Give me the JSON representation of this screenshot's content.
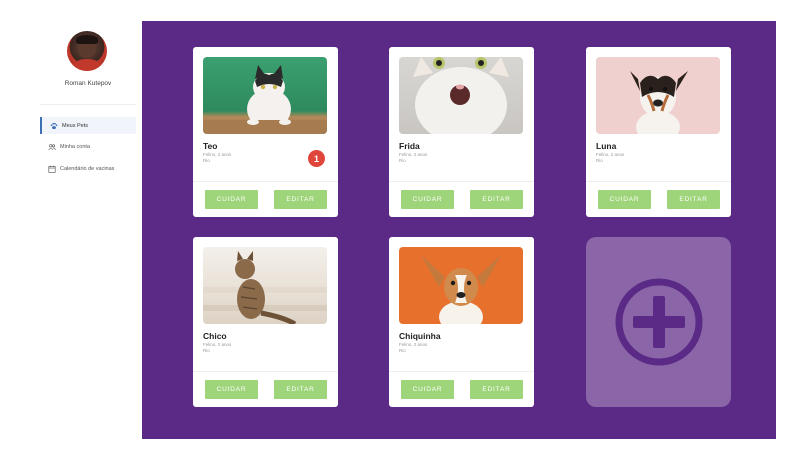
{
  "user": {
    "name": "Roman Kutepov"
  },
  "nav": {
    "items": [
      {
        "label": "Meus Pets",
        "icon": "paw-icon",
        "active": true
      },
      {
        "label": "Minha conta",
        "icon": "people-icon",
        "active": false
      },
      {
        "label": "Calendário de vacinas",
        "icon": "calendar-icon",
        "active": false
      }
    ]
  },
  "pets": [
    {
      "name": "Teo",
      "meta": "Felino, 2 anos",
      "sub": "Rio",
      "badge": "1",
      "care_label": "CUIDAR",
      "edit_label": "EDITAR"
    },
    {
      "name": "Frida",
      "meta": "Felino, 2 anos",
      "sub": "Rio",
      "care_label": "CUIDAR",
      "edit_label": "EDITAR"
    },
    {
      "name": "Luna",
      "meta": "Felino, 2 anos",
      "sub": "Rio",
      "care_label": "CUIDAR",
      "edit_label": "EDITAR"
    },
    {
      "name": "Chico",
      "meta": "Felino, 2 anos",
      "sub": "Rio",
      "care_label": "CUIDAR",
      "edit_label": "EDITAR"
    },
    {
      "name": "Chiquinha",
      "meta": "Felino, 2 anos",
      "sub": "Rio",
      "care_label": "CUIDAR",
      "edit_label": "EDITAR"
    }
  ],
  "colors": {
    "main_bg": "#5b2a86",
    "add_card_bg": "#8a66a8",
    "button_bg": "#9ed47a",
    "badge_bg": "#e0453c",
    "nav_active": "#3b6fb6"
  },
  "icons": {
    "add": "plus-circle-icon"
  }
}
